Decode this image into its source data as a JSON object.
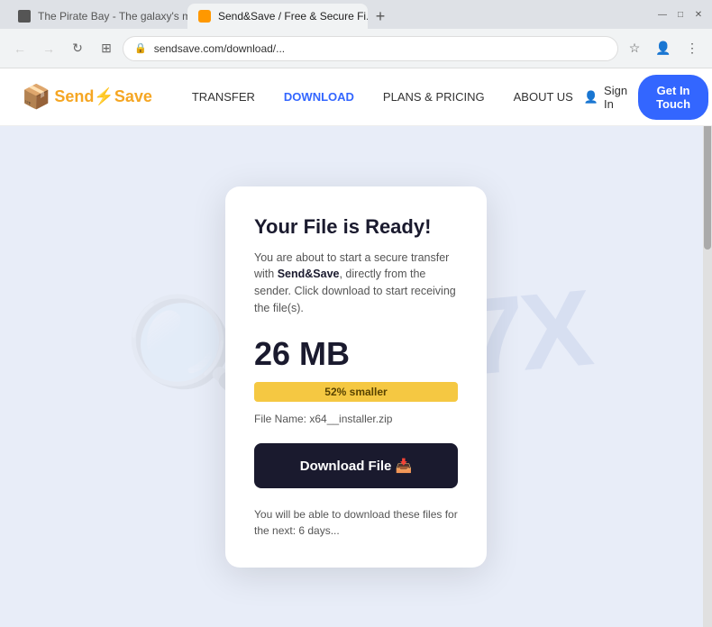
{
  "browser": {
    "tabs": [
      {
        "id": "tab1",
        "favicon": "pirate",
        "title": "The Pirate Bay - The galaxy's m...",
        "active": false
      },
      {
        "id": "tab2",
        "favicon": "send",
        "title": "Send&Save / Free & Secure Fi...",
        "active": true
      }
    ],
    "new_tab_label": "+",
    "address": "sendsave.com/download/...",
    "nav": {
      "back": "←",
      "forward": "→",
      "reload": "↻",
      "security": "⊞"
    },
    "window_controls": {
      "minimize": "—",
      "maximize": "□",
      "close": "✕"
    }
  },
  "site": {
    "logo_text_part1": "Send",
    "logo_text_part2": "Save",
    "nav_links": [
      {
        "id": "transfer",
        "label": "TRANSFER",
        "active": false
      },
      {
        "id": "download",
        "label": "DOWNLOAD",
        "active": true
      },
      {
        "id": "plans",
        "label": "PLANS & PRICING",
        "active": false
      },
      {
        "id": "about",
        "label": "ABOUT US",
        "active": false
      }
    ],
    "sign_in_label": "Sign In",
    "get_touch_label": "Get In Touch"
  },
  "card": {
    "title": "Your File is Ready!",
    "description_prefix": "You are about to start a secure transfer with ",
    "brand_name": "Send&Save",
    "description_suffix": ", directly from the sender. Click download to start receiving the file(s).",
    "file_size": "26 MB",
    "progress_label": "52% smaller",
    "progress_percent": 100,
    "file_name_label": "File Name:",
    "file_name_value": "x64__installer.zip",
    "download_button_label": "Download File 📥",
    "expiry_text": "You will be able to download these files for the next: 6 days..."
  },
  "colors": {
    "accent_blue": "#3366ff",
    "brand_dark": "#1a1a2e",
    "progress_bg": "#f5e6a0",
    "progress_fill": "#f5c842",
    "bg_page": "#e8edf8"
  }
}
